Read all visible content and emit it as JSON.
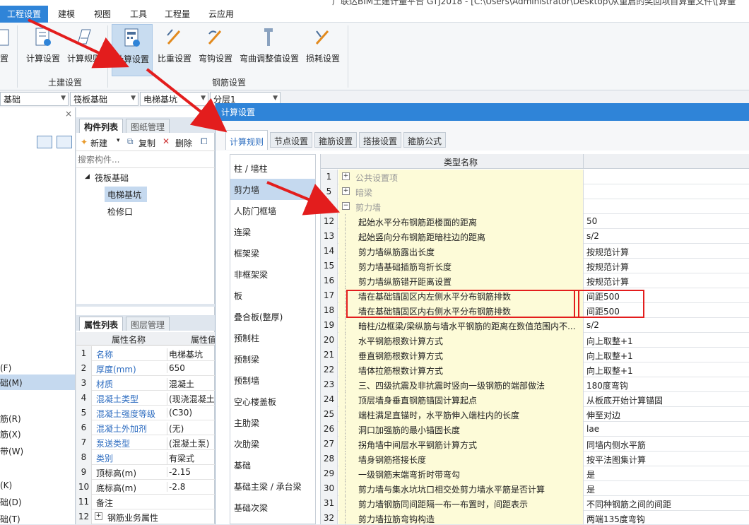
{
  "window_title": "广联达BIM土建计量平台 GTJ2018 - [C:\\Users\\Administrator\\Desktop\\从重启的奖回项目算量文件\\[算量",
  "menu": [
    "工程设置",
    "建模",
    "视图",
    "工具",
    "工程量",
    "云应用"
  ],
  "ribbon": {
    "left_cut_label": "置",
    "civil": {
      "buttons": [
        "计算设置",
        "计算规则"
      ],
      "group": "土建设置"
    },
    "rebar": {
      "buttons": [
        "计算设置",
        "比重设置",
        "弯钩设置",
        "弯曲调整值设置",
        "损耗设置"
      ],
      "group": "钢筋设置"
    }
  },
  "selectors": [
    "基础",
    "筏板基础",
    "电梯基坑",
    "分层1"
  ],
  "left_pane": {
    "close": "×",
    "items": [
      "(F)",
      "础(M)",
      "筋(R)",
      "筋(X)",
      "带(W)",
      "(K)",
      "础(D)",
      "础(T)",
      "(V)"
    ]
  },
  "component_panel": {
    "tabs": [
      "构件列表",
      "图纸管理"
    ],
    "toolbar": {
      "new": "新建",
      "copy": "复制",
      "delete": "删除"
    },
    "search_placeholder": "搜索构件...",
    "tree": {
      "parent": "筏板基础",
      "children": [
        "电梯基坑",
        "检修口"
      ]
    }
  },
  "property_panel": {
    "tabs": [
      "属性列表",
      "图层管理"
    ],
    "headers": [
      "属性名称",
      "属性值"
    ],
    "rows": [
      {
        "n": "1",
        "name": "名称",
        "value": "电梯基坑"
      },
      {
        "n": "2",
        "name": "厚度(mm)",
        "value": "650"
      },
      {
        "n": "3",
        "name": "材质",
        "value": "混凝土"
      },
      {
        "n": "4",
        "name": "混凝土类型",
        "value": "(现浇混凝土碎"
      },
      {
        "n": "5",
        "name": "混凝土强度等级",
        "value": "(C30)"
      },
      {
        "n": "6",
        "name": "混凝土外加剂",
        "value": "(无)"
      },
      {
        "n": "7",
        "name": "泵送类型",
        "value": "(混凝土泵)"
      },
      {
        "n": "8",
        "name": "类别",
        "value": "有梁式"
      },
      {
        "n": "9",
        "name": "顶标高(m)",
        "value": "-2.15"
      },
      {
        "n": "10",
        "name": "底标高(m)",
        "value": "-2.8"
      },
      {
        "n": "11",
        "name": "备注",
        "value": ""
      },
      {
        "n": "12",
        "name": "钢筋业务属性",
        "value": ""
      }
    ]
  },
  "dialog": {
    "title": "计算设置",
    "tabs": [
      "计算规则",
      "节点设置",
      "箍筋设置",
      "搭接设置",
      "箍筋公式"
    ],
    "categories": [
      "柱 / 墙柱",
      "剪力墙",
      "人防门框墙",
      "连梁",
      "框架梁",
      "非框架梁",
      "板",
      "叠合板(整厚)",
      "预制柱",
      "预制梁",
      "预制墙",
      "空心楼盖板",
      "主肋梁",
      "次肋梁",
      "基础",
      "基础主梁 / 承台梁",
      "基础次梁"
    ],
    "grid_header": "类型名称",
    "groups": [
      {
        "n": "1",
        "name": "公共设置项"
      },
      {
        "n": "5",
        "name": "暗梁"
      },
      {
        "n": "",
        "name": "剪力墙"
      }
    ],
    "rows": [
      {
        "n": "12",
        "name": "起始水平分布钢筋距楼面的距离",
        "value": "50"
      },
      {
        "n": "13",
        "name": "起始竖向分布钢筋距暗柱边的距离",
        "value": "s/2"
      },
      {
        "n": "14",
        "name": "剪力墙纵筋露出长度",
        "value": "按规范计算"
      },
      {
        "n": "15",
        "name": "剪力墙基础插筋弯折长度",
        "value": "按规范计算"
      },
      {
        "n": "16",
        "name": "剪力墙纵筋错开距离设置",
        "value": "按规范计算"
      },
      {
        "n": "17",
        "name": "墙在基础锚固区内左侧水平分布钢筋排数",
        "value": "间距500"
      },
      {
        "n": "18",
        "name": "墙在基础锚固区内右侧水平分布钢筋排数",
        "value": "间距500"
      },
      {
        "n": "19",
        "name": "暗柱/边框梁/梁纵筋与墙水平钢筋的距离在数值范围内不...",
        "value": "s/2"
      },
      {
        "n": "20",
        "name": "水平钢筋根数计算方式",
        "value": "向上取整+1"
      },
      {
        "n": "21",
        "name": "垂直钢筋根数计算方式",
        "value": "向上取整+1"
      },
      {
        "n": "22",
        "name": "墙体拉筋根数计算方式",
        "value": "向上取整+1"
      },
      {
        "n": "23",
        "name": "三、四级抗震及非抗震时竖向一级钢筋的端部做法",
        "value": "180度弯钩"
      },
      {
        "n": "24",
        "name": "顶层墙身垂直钢筋锚固计算起点",
        "value": "从板底开始计算锚固"
      },
      {
        "n": "25",
        "name": "端柱满足直锚时，水平筋伸入端柱内的长度",
        "value": "伸至对边"
      },
      {
        "n": "26",
        "name": "洞口加强筋的最小锚固长度",
        "value": "lae"
      },
      {
        "n": "27",
        "name": "拐角墙中间层水平钢筋计算方式",
        "value": "同墙内侧水平筋"
      },
      {
        "n": "28",
        "name": "墙身钢筋搭接长度",
        "value": "按平法图集计算"
      },
      {
        "n": "29",
        "name": "一级钢筋末端弯折时带弯勾",
        "value": "是"
      },
      {
        "n": "30",
        "name": "剪力墙与集水坑坑口相交处剪力墙水平筋是否计算",
        "value": "是"
      },
      {
        "n": "31",
        "name": "剪力墙钢筋同间距隔一布一布置时，间距表示",
        "value": "不同种钢筋之间的间距"
      },
      {
        "n": "32",
        "name": "剪力墙拉筋弯钩构造",
        "value": "两端135度弯钩"
      }
    ]
  },
  "colors": {
    "accent": "#2f84d8",
    "annotation": "#e31d1d",
    "name_cell": "#fdfbd8",
    "selected": "#c5d9ef"
  }
}
